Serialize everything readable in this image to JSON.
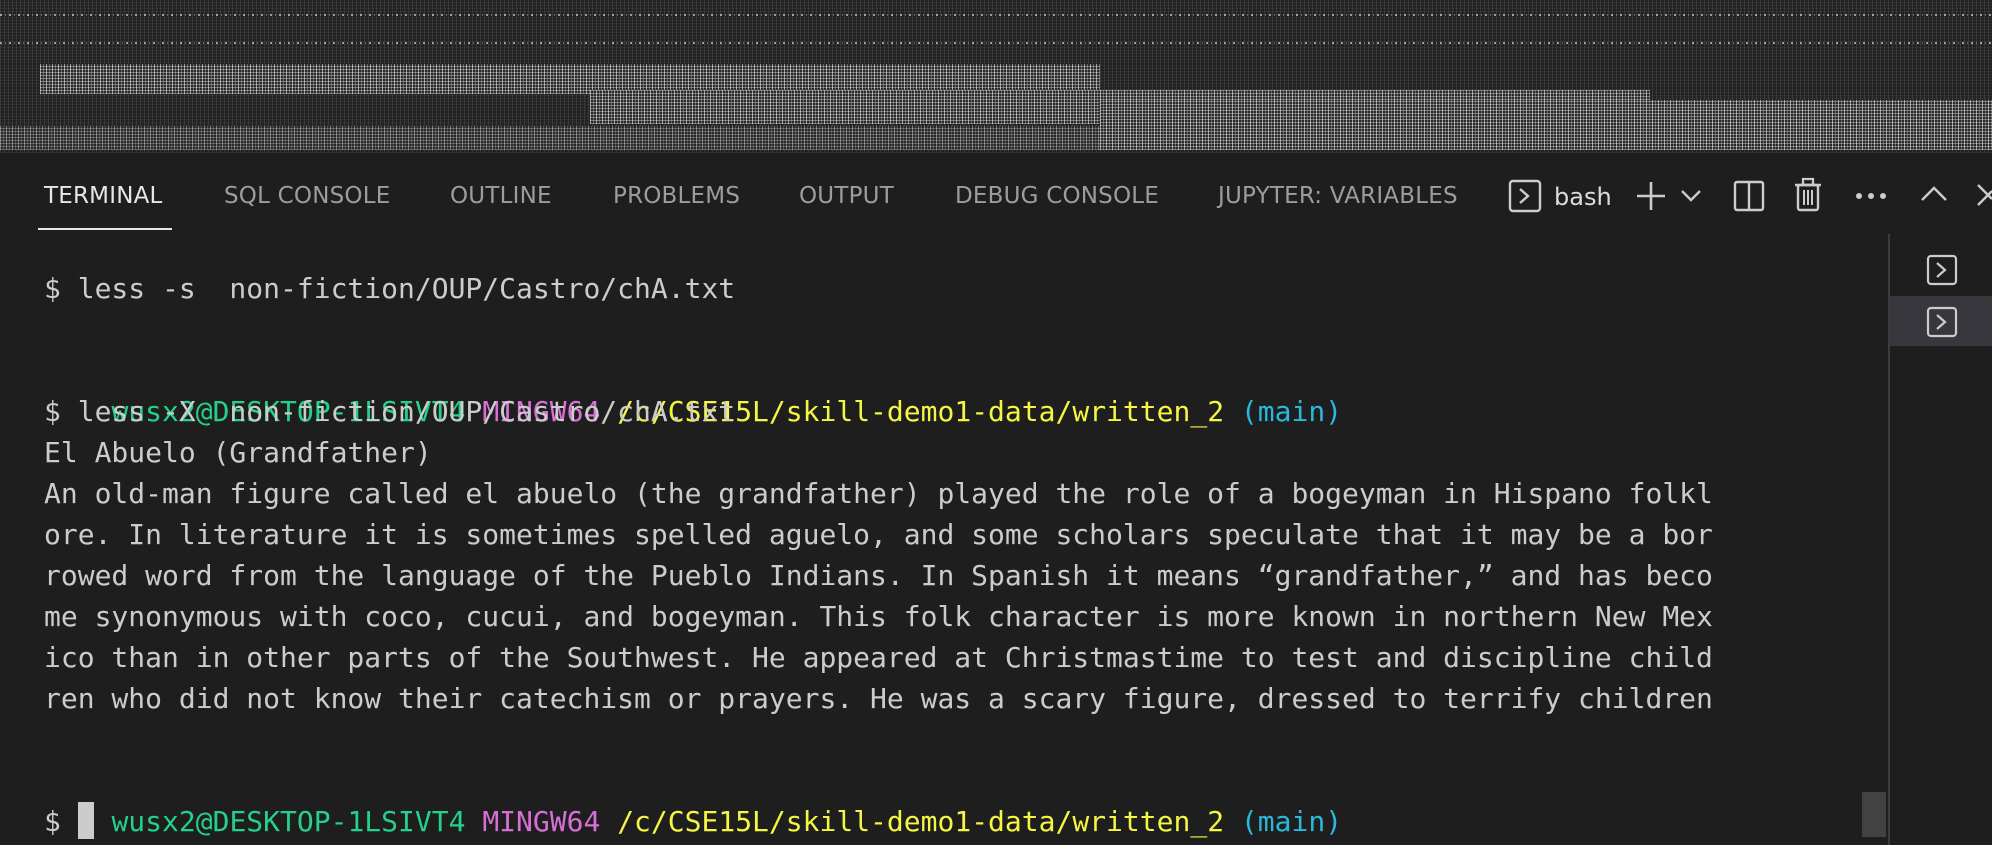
{
  "panel": {
    "tabs": [
      {
        "label": "TERMINAL",
        "active": true
      },
      {
        "label": "SQL CONSOLE",
        "active": false
      },
      {
        "label": "OUTLINE",
        "active": false
      },
      {
        "label": "PROBLEMS",
        "active": false
      },
      {
        "label": "OUTPUT",
        "active": false
      },
      {
        "label": "DEBUG CONSOLE",
        "active": false
      },
      {
        "label": "JUPYTER: VARIABLES",
        "active": false
      }
    ],
    "toolbar": {
      "shell_label": "bash",
      "icons": [
        "terminal-icon",
        "plus-icon",
        "chevron-down-icon",
        "split-icon",
        "trash-icon",
        "ellipsis-icon",
        "chevron-up-icon",
        "close-icon"
      ]
    }
  },
  "terminal": {
    "lines": [
      {
        "type": "command",
        "text": "$ less -s  non-fiction/OUP/Castro/chA.txt"
      },
      {
        "type": "prompt",
        "user": "wusx2@DESKTOP-1LSIVT4",
        "env": "MINGW64",
        "path": "/c/CSE15L/skill-demo1-data/written_2",
        "branch": "(main)"
      },
      {
        "type": "command",
        "text": "$ less -X  non-fiction/OUP/Castro/chA.txt"
      },
      {
        "type": "output",
        "text": "El Abuelo (Grandfather)"
      },
      {
        "type": "output",
        "text": "An old-man figure called el abuelo (the grandfather) played the role of a bogeyman in Hispano folkl"
      },
      {
        "type": "output",
        "text": "ore. In literature it is sometimes spelled aguelo, and some scholars speculate that it may be a bor"
      },
      {
        "type": "output",
        "text": "rowed word from the language of the Pueblo Indians. In Spanish it means “grandfather,” and has beco"
      },
      {
        "type": "output",
        "text": "me synonymous with coco, cucui, and bogeyman. This folk character is more known in northern New Mex"
      },
      {
        "type": "output",
        "text": "ico than in other parts of the Southwest. He appeared at Christmastime to test and discipline child"
      },
      {
        "type": "output",
        "text": "ren who did not know their catechism or prayers. He was a scary figure, dressed to terrify children"
      },
      {
        "type": "prompt",
        "user": "wusx2@DESKTOP-1LSIVT4",
        "env": "MINGW64",
        "path": "/c/CSE15L/skill-demo1-data/written_2",
        "branch": "(main)"
      },
      {
        "type": "input",
        "text": "$ "
      }
    ]
  },
  "terminal_list": {
    "items": [
      {
        "icon": "terminal-icon",
        "selected": false
      },
      {
        "icon": "terminal-icon",
        "selected": true
      }
    ]
  },
  "colors": {
    "background": "#1e1e1e",
    "prompt_user": "#23d18b",
    "prompt_env": "#d670d6",
    "prompt_path": "#f5f543",
    "prompt_branch": "#29b8db",
    "text": "#cccccc"
  }
}
